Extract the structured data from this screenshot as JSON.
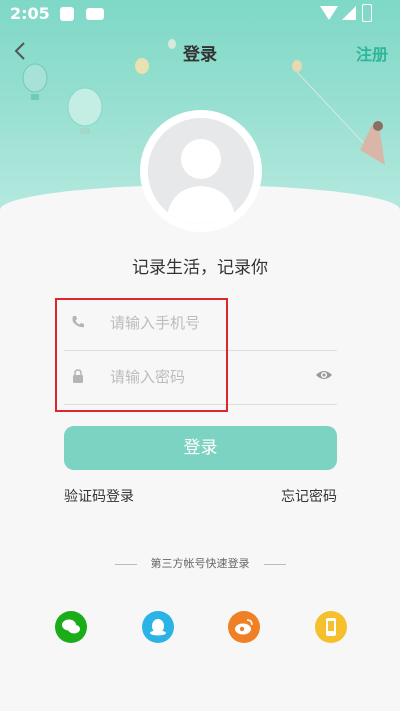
{
  "status_bar": {
    "time": "2:05"
  },
  "nav": {
    "title": "登录",
    "register_label": "注册"
  },
  "slogan": "记录生活，记录你",
  "form": {
    "phone_placeholder": "请输入手机号",
    "password_placeholder": "请输入密码"
  },
  "login_button": "登录",
  "sms_login": "验证码登录",
  "forgot_password": "忘记密码",
  "third_party": {
    "title": "第三方帐号快速登录",
    "items": [
      "wechat-icon",
      "qq-icon",
      "weibo-icon",
      "phone-icon"
    ]
  },
  "colors": {
    "accent": "#7dd3c1",
    "register": "#2fb59b",
    "highlight": "#e0262d"
  }
}
